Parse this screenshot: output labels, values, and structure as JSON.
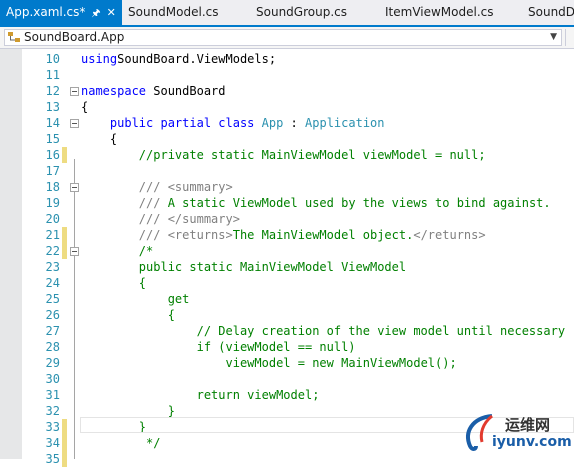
{
  "tabs": [
    {
      "label": "App.xaml.cs*",
      "active": true
    },
    {
      "label": "SoundModel.cs",
      "active": false
    },
    {
      "label": "SoundGroup.cs",
      "active": false
    },
    {
      "label": "ItemViewModel.cs",
      "active": false
    },
    {
      "label": "SoundDa",
      "active": false
    }
  ],
  "navbar": {
    "class_name": "SoundBoard.App"
  },
  "icons": {
    "pin": "pin-icon",
    "close": "close-icon",
    "class": "class-icon",
    "dropdown": "chevron-down-icon"
  },
  "colors": {
    "accent": "#007acc",
    "keyword": "#0000ff",
    "type": "#2b91af",
    "comment": "#008000",
    "doc": "#808080",
    "change_marker": "#eedc82"
  },
  "lines": [
    {
      "n": "10",
      "segs": [
        [
          "kw",
          "using"
        ],
        [
          "",
          "SoundBoard.ViewModels;"
        ]
      ],
      "chg": false,
      "fold": false
    },
    {
      "n": "11",
      "segs": [],
      "chg": false,
      "fold": false
    },
    {
      "n": "12",
      "segs": [
        [
          "kw",
          "namespace"
        ],
        [
          "",
          " SoundBoard"
        ]
      ],
      "chg": false,
      "fold": true
    },
    {
      "n": "13",
      "segs": [
        [
          "",
          "{"
        ]
      ],
      "chg": false,
      "fold": false
    },
    {
      "n": "14",
      "segs": [
        [
          "",
          "    "
        ],
        [
          "kw",
          "public partial class"
        ],
        [
          "",
          " "
        ],
        [
          "type",
          "App"
        ],
        [
          "",
          " : "
        ],
        [
          "type",
          "Application"
        ]
      ],
      "chg": false,
      "fold": true
    },
    {
      "n": "15",
      "segs": [
        [
          "",
          "    {"
        ]
      ],
      "chg": false,
      "fold": false
    },
    {
      "n": "16",
      "segs": [
        [
          "",
          "        "
        ],
        [
          "cm",
          "//private static MainViewModel viewModel = null;"
        ]
      ],
      "chg": true,
      "fold": false
    },
    {
      "n": "17",
      "segs": [],
      "chg": false,
      "fold": false
    },
    {
      "n": "18",
      "segs": [
        [
          "",
          "        "
        ],
        [
          "doc",
          "/// <summary>"
        ]
      ],
      "chg": false,
      "fold": true
    },
    {
      "n": "19",
      "segs": [
        [
          "",
          "        "
        ],
        [
          "doc",
          "///"
        ],
        [
          "cm",
          " A static ViewModel used by the views to bind against."
        ]
      ],
      "chg": false,
      "fold": false
    },
    {
      "n": "20",
      "segs": [
        [
          "",
          "        "
        ],
        [
          "doc",
          "/// </summary>"
        ]
      ],
      "chg": false,
      "fold": false
    },
    {
      "n": "21",
      "segs": [
        [
          "",
          "        "
        ],
        [
          "doc",
          "/// <returns>"
        ],
        [
          "cm",
          "The MainViewModel object."
        ],
        [
          "doc",
          "</returns>"
        ]
      ],
      "chg": true,
      "fold": false
    },
    {
      "n": "22",
      "segs": [
        [
          "",
          "        "
        ],
        [
          "cm",
          "/*"
        ]
      ],
      "chg": true,
      "fold": true
    },
    {
      "n": "23",
      "segs": [
        [
          "",
          "        "
        ],
        [
          "cm",
          "public static MainViewModel ViewModel"
        ]
      ],
      "chg": false,
      "fold": false
    },
    {
      "n": "24",
      "segs": [
        [
          "",
          "        "
        ],
        [
          "cm",
          "{"
        ]
      ],
      "chg": false,
      "fold": false
    },
    {
      "n": "25",
      "segs": [
        [
          "",
          "            "
        ],
        [
          "cm",
          "get"
        ]
      ],
      "chg": false,
      "fold": false
    },
    {
      "n": "26",
      "segs": [
        [
          "",
          "            "
        ],
        [
          "cm",
          "{"
        ]
      ],
      "chg": false,
      "fold": false
    },
    {
      "n": "27",
      "segs": [
        [
          "",
          "                "
        ],
        [
          "cm",
          "// Delay creation of the view model until necessary"
        ]
      ],
      "chg": false,
      "fold": false
    },
    {
      "n": "28",
      "segs": [
        [
          "",
          "                "
        ],
        [
          "cm",
          "if (viewModel == null)"
        ]
      ],
      "chg": false,
      "fold": false
    },
    {
      "n": "29",
      "segs": [
        [
          "",
          "                    "
        ],
        [
          "cm",
          "viewModel = new MainViewModel();"
        ]
      ],
      "chg": false,
      "fold": false
    },
    {
      "n": "30",
      "segs": [],
      "chg": false,
      "fold": false
    },
    {
      "n": "31",
      "segs": [
        [
          "",
          "                "
        ],
        [
          "cm",
          "return viewModel;"
        ]
      ],
      "chg": false,
      "fold": false
    },
    {
      "n": "32",
      "segs": [
        [
          "",
          "            "
        ],
        [
          "cm",
          "}"
        ]
      ],
      "chg": false,
      "fold": false
    },
    {
      "n": "33",
      "segs": [
        [
          "",
          "        "
        ],
        [
          "cm",
          "}"
        ]
      ],
      "chg": true,
      "fold": false
    },
    {
      "n": "34",
      "segs": [
        [
          "",
          "         "
        ],
        [
          "cm",
          "*/"
        ]
      ],
      "chg": true,
      "fold": false
    },
    {
      "n": "35",
      "segs": [],
      "chg": true,
      "fold": false
    }
  ],
  "watermark": {
    "line1": "运维网",
    "line2": "iyunv.com"
  }
}
